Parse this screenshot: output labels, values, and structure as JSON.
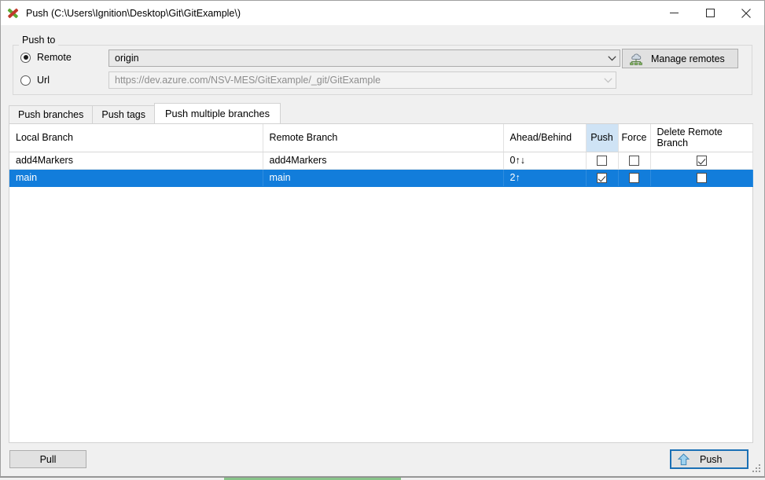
{
  "window": {
    "title": "Push (C:\\Users\\Ignition\\Desktop\\Git\\GitExample\\)",
    "app_icon": "smartgit-x-icon",
    "minimize_label": "—",
    "maximize_label": "☐",
    "close_label": "✕"
  },
  "push_to": {
    "group_title": "Push to",
    "remote_radio_label": "Remote",
    "url_radio_label": "Url",
    "remote_selected": true,
    "remote_combo_value": "origin",
    "url_combo_value": "https://dev.azure.com/NSV-MES/GitExample/_git/GitExample",
    "manage_remotes_label": "Manage remotes",
    "manage_remotes_icon": "cloud-network-icon"
  },
  "tabs": [
    {
      "label": "Push branches",
      "active": false
    },
    {
      "label": "Push tags",
      "active": false
    },
    {
      "label": "Push multiple branches",
      "active": true
    }
  ],
  "table": {
    "columns": [
      "Local Branch",
      "Remote Branch",
      "Ahead/Behind",
      "Push",
      "Force",
      "Delete Remote Branch"
    ],
    "highlighted_column": "Push",
    "rows": [
      {
        "local_branch": "add4Markers",
        "remote_branch": "add4Markers",
        "ahead_behind": "0↑↓",
        "push": false,
        "force": false,
        "delete_remote": true,
        "selected": false
      },
      {
        "local_branch": "main",
        "remote_branch": "main",
        "ahead_behind": "2↑",
        "push": true,
        "force": false,
        "delete_remote": false,
        "selected": true
      }
    ]
  },
  "footer": {
    "pull_label": "Pull",
    "push_label": "Push",
    "push_icon": "blue-up-arrow-icon",
    "push_is_default": true
  },
  "colors": {
    "selection_blue": "#127ddb",
    "header_highlight": "#cfe3f5",
    "default_button_border": "#1a6fb5",
    "progress_green": "#89c48a"
  }
}
